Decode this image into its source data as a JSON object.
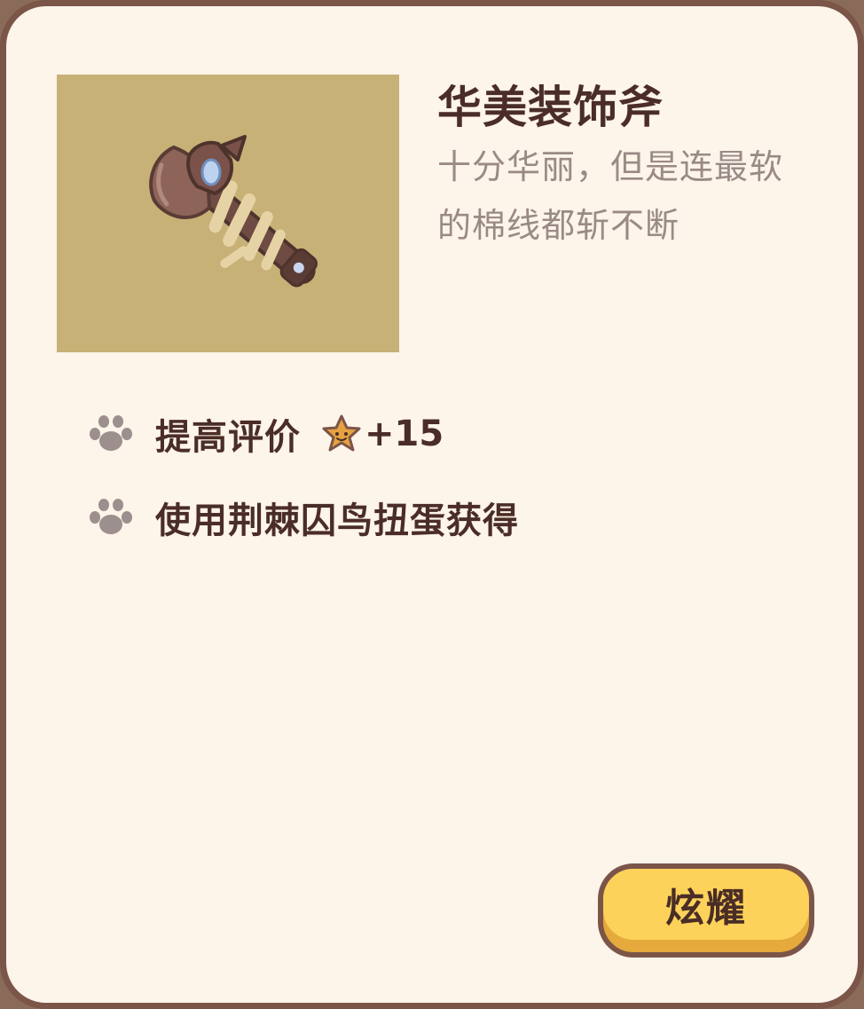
{
  "item": {
    "name": "华美装饰斧",
    "description": "十分华丽，但是连最软的棉线都斩不断",
    "image_icon": "decorative-axe-icon"
  },
  "attributes": [
    {
      "icon": "paw-icon",
      "label": "提高评价",
      "bonus_icon": "star-icon",
      "bonus": "+15"
    },
    {
      "icon": "paw-icon",
      "label": "使用荆棘囚鸟扭蛋获得"
    }
  ],
  "actions": {
    "show_label": "炫耀"
  },
  "colors": {
    "card_background": "#fdf4ea",
    "card_border": "#7b5548",
    "image_background": "#c7b177",
    "title_text": "#4a2d26",
    "description_text": "#9a8a86",
    "button_face": "#fcd25a",
    "button_shadow": "#e5a93c"
  }
}
